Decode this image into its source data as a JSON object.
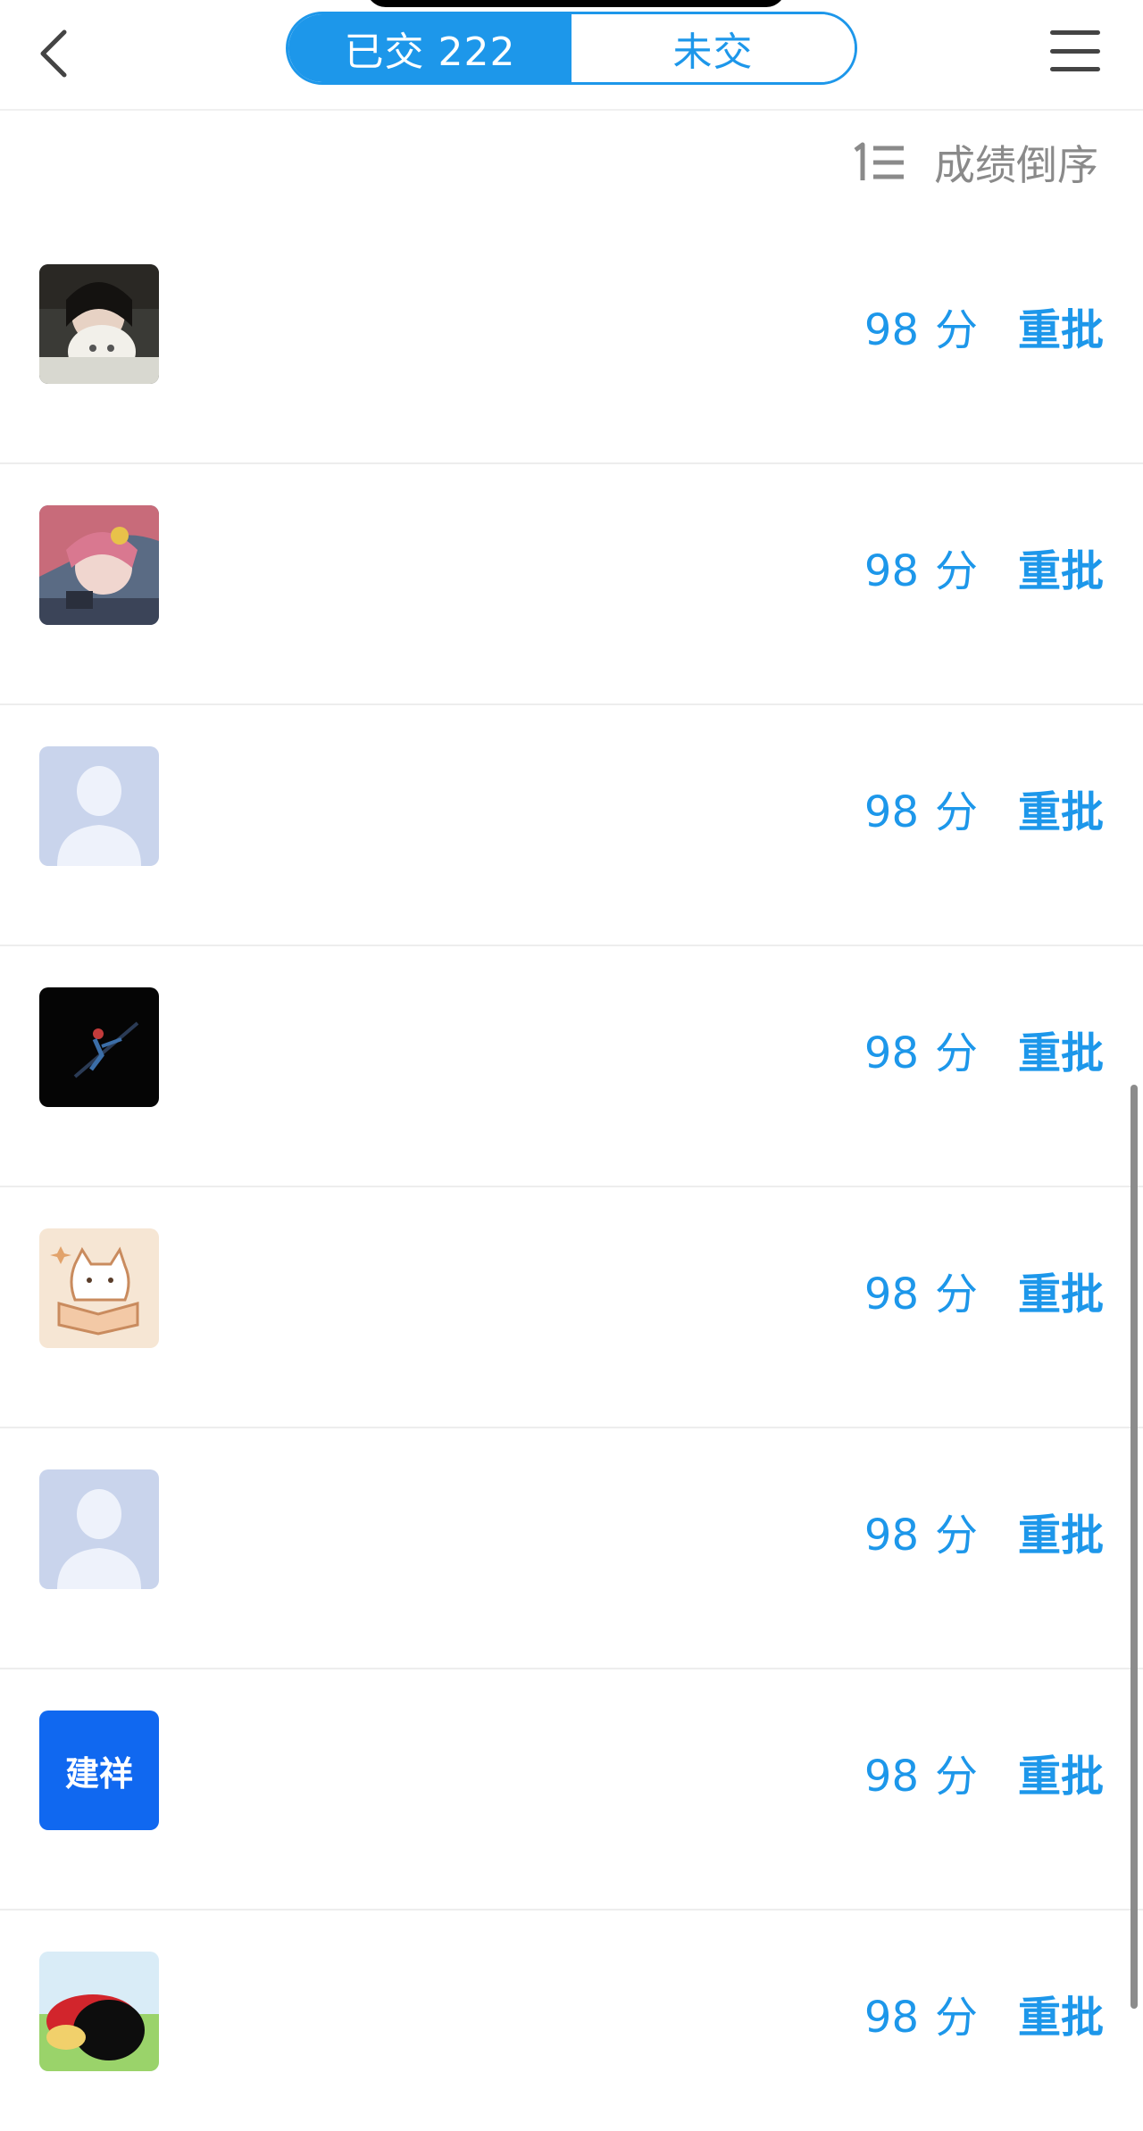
{
  "header": {
    "tab_submitted": "已交 222",
    "tab_unsubmitted": "未交"
  },
  "sort": {
    "label": "成绩倒序"
  },
  "rows": [
    {
      "score": "98",
      "unit": "分",
      "action": "重批",
      "avatar": "photo-girl-with-cat"
    },
    {
      "score": "98",
      "unit": "分",
      "action": "重批",
      "avatar": "anime-character"
    },
    {
      "score": "98",
      "unit": "分",
      "action": "重批",
      "avatar": "default-user-silhouette"
    },
    {
      "score": "98",
      "unit": "分",
      "action": "重批",
      "avatar": "dark-figure"
    },
    {
      "score": "98",
      "unit": "分",
      "action": "重批",
      "avatar": "cartoon-cat-reading"
    },
    {
      "score": "98",
      "unit": "分",
      "action": "重批",
      "avatar": "default-user-silhouette"
    },
    {
      "score": "98",
      "unit": "分",
      "action": "重批",
      "avatar": "text-avatar",
      "avatar_text": "建祥"
    },
    {
      "score": "98",
      "unit": "分",
      "action": "重批",
      "avatar": "cartoon-character-lying"
    }
  ],
  "colors": {
    "accent": "#1d97ea",
    "sort_text": "#8a8a8a",
    "text_avatar_bg": "#1068f0"
  }
}
